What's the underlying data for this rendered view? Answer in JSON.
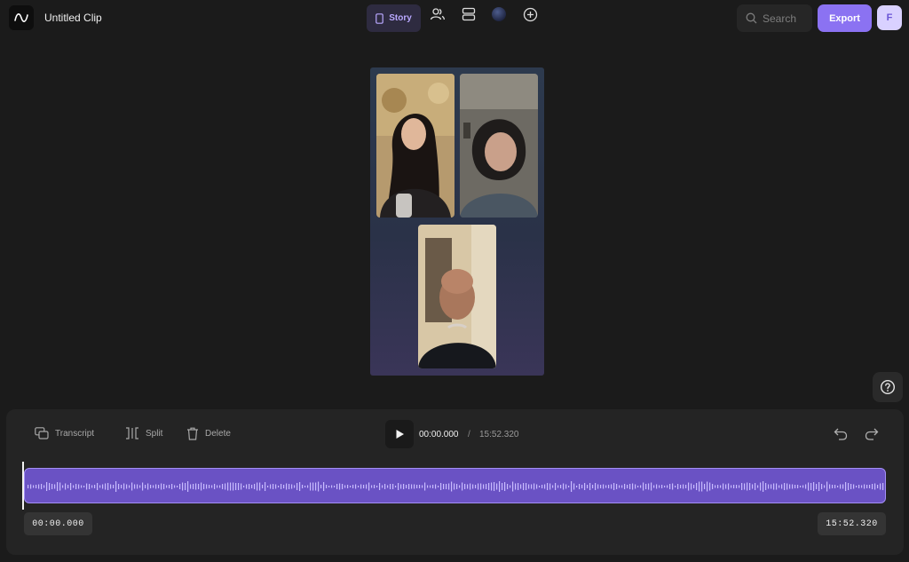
{
  "app": {
    "title": "Untitled Clip"
  },
  "nav": {
    "story_label": "Story"
  },
  "search": {
    "placeholder": "Search"
  },
  "actions": {
    "export_label": "Export",
    "avatar_initial": "F"
  },
  "timeline": {
    "tools": {
      "transcript": "Transcript",
      "split": "Split",
      "delete": "Delete"
    },
    "current_time": "00:00.000",
    "separator": "/",
    "total_time": "15:52.320",
    "start_stamp": "00:00.000",
    "end_stamp": "15:52.320",
    "playhead_position": 0
  },
  "colors": {
    "accent": "#8b72f2",
    "track": "#6a52c4",
    "background": "#1b1b1b"
  },
  "icons": [
    "logo-wave-icon",
    "phone-icon",
    "people-icon",
    "layout-icon",
    "background-orb-icon",
    "add-circle-icon",
    "search-icon",
    "help-icon",
    "transcript-icon",
    "split-icon",
    "trash-icon",
    "play-icon",
    "undo-icon",
    "redo-icon"
  ]
}
